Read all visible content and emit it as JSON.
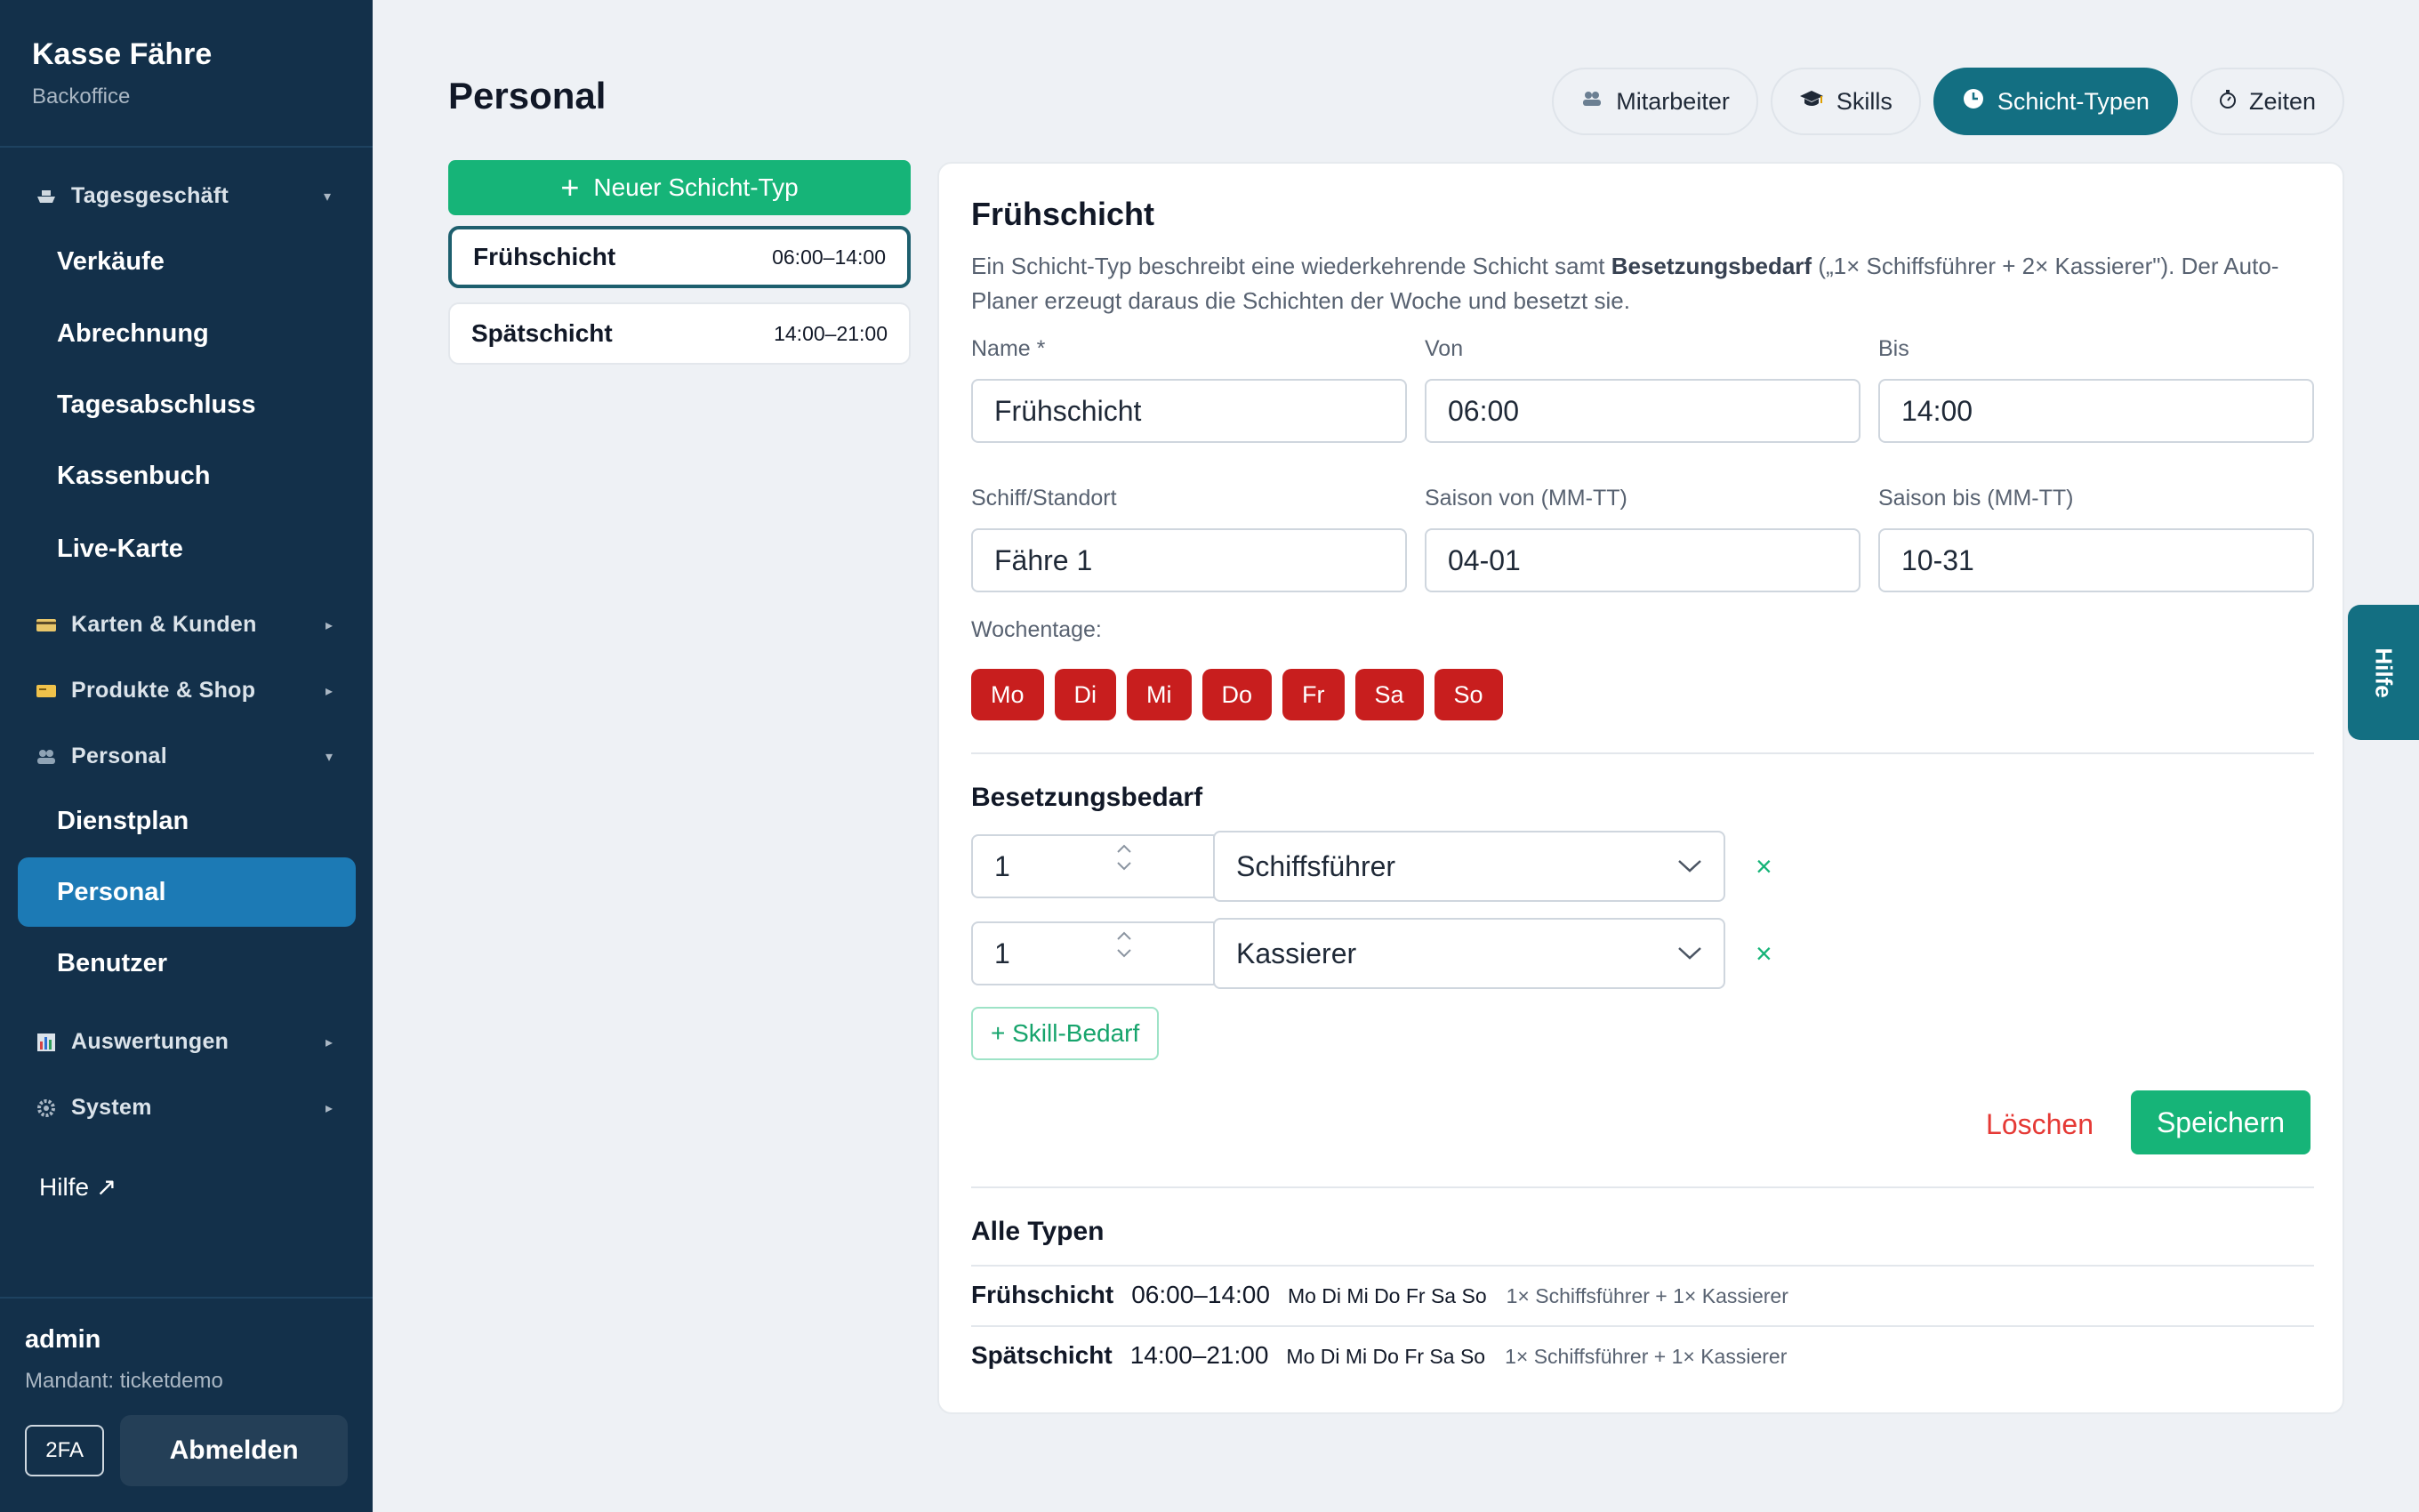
{
  "brand": {
    "title": "Kasse Fähre",
    "subtitle": "Backoffice"
  },
  "sidebar": {
    "groups": {
      "tagesgeschaeft": "Tagesgeschäft",
      "karten": "Karten & Kunden",
      "produkte": "Produkte & Shop",
      "personal": "Personal",
      "auswertungen": "Auswertungen",
      "system": "System"
    },
    "items": {
      "verkaeufe": "Verkäufe",
      "abrechnung": "Abrechnung",
      "tagesabschluss": "Tagesabschluss",
      "kassenbuch": "Kassenbuch",
      "livekarte": "Live-Karte",
      "dienstplan": "Dienstplan",
      "personal": "Personal",
      "benutzer": "Benutzer"
    },
    "help": "Hilfe ↗",
    "user": "admin",
    "tenant": "Mandant: ticketdemo",
    "twofa": "2FA",
    "logout": "Abmelden"
  },
  "page": {
    "title": "Personal"
  },
  "tabs": {
    "mitarbeiter": "Mitarbeiter",
    "skills": "Skills",
    "schichttypen": "Schicht-Typen",
    "zeiten": "Zeiten"
  },
  "list": {
    "new_button": "Neuer Schicht-Typ",
    "types": [
      {
        "name": "Frühschicht",
        "time": "06:00–14:00"
      },
      {
        "name": "Spätschicht",
        "time": "14:00–21:00"
      }
    ]
  },
  "form": {
    "title": "Frühschicht",
    "desc_pre": "Ein Schicht-Typ beschreibt eine wiederkehrende Schicht samt ",
    "desc_bold": "Besetzungsbedarf",
    "desc_post": " („1× Schiffsführer + 2× Kassierer\"). Der Auto-Planer erzeugt daraus die Schichten der Woche und besetzt sie.",
    "labels": {
      "name": "Name *",
      "von": "Von",
      "bis": "Bis",
      "schiff": "Schiff/Standort",
      "saison_von": "Saison von (MM-TT)",
      "saison_bis": "Saison bis (MM-TT)",
      "wochentage": "Wochentage:"
    },
    "values": {
      "name": "Frühschicht",
      "von": "06:00",
      "bis": "14:00",
      "schiff": "Fähre 1",
      "saison_von": "04-01",
      "saison_bis": "10-31"
    },
    "days": [
      "Mo",
      "Di",
      "Mi",
      "Do",
      "Fr",
      "Sa",
      "So"
    ],
    "besetzung_title": "Besetzungsbedarf",
    "requirements": [
      {
        "qty": "1",
        "role": "Schiffsführer"
      },
      {
        "qty": "1",
        "role": "Kassierer"
      }
    ],
    "remove_symbol": "×",
    "add_skill": "+ Skill-Bedarf",
    "delete": "Löschen",
    "save": "Speichern"
  },
  "all_types": {
    "title": "Alle Typen",
    "rows": [
      {
        "name": "Frühschicht",
        "time": "06:00–14:00",
        "days": "Mo Di Mi Do Fr Sa So",
        "req": "1× Schiffsführer + 1× Kassierer"
      },
      {
        "name": "Spätschicht",
        "time": "14:00–21:00",
        "days": "Mo Di Mi Do Fr Sa So",
        "req": "1× Schiffsführer + 1× Kassierer"
      }
    ]
  },
  "help_tab": "Hilfe",
  "colors": {
    "sidebar": "#13304a",
    "accent": "#136f82",
    "primary": "#16b478",
    "day": "#c81e1e",
    "danger": "#e53935",
    "active_nav": "#1c7ab5"
  }
}
